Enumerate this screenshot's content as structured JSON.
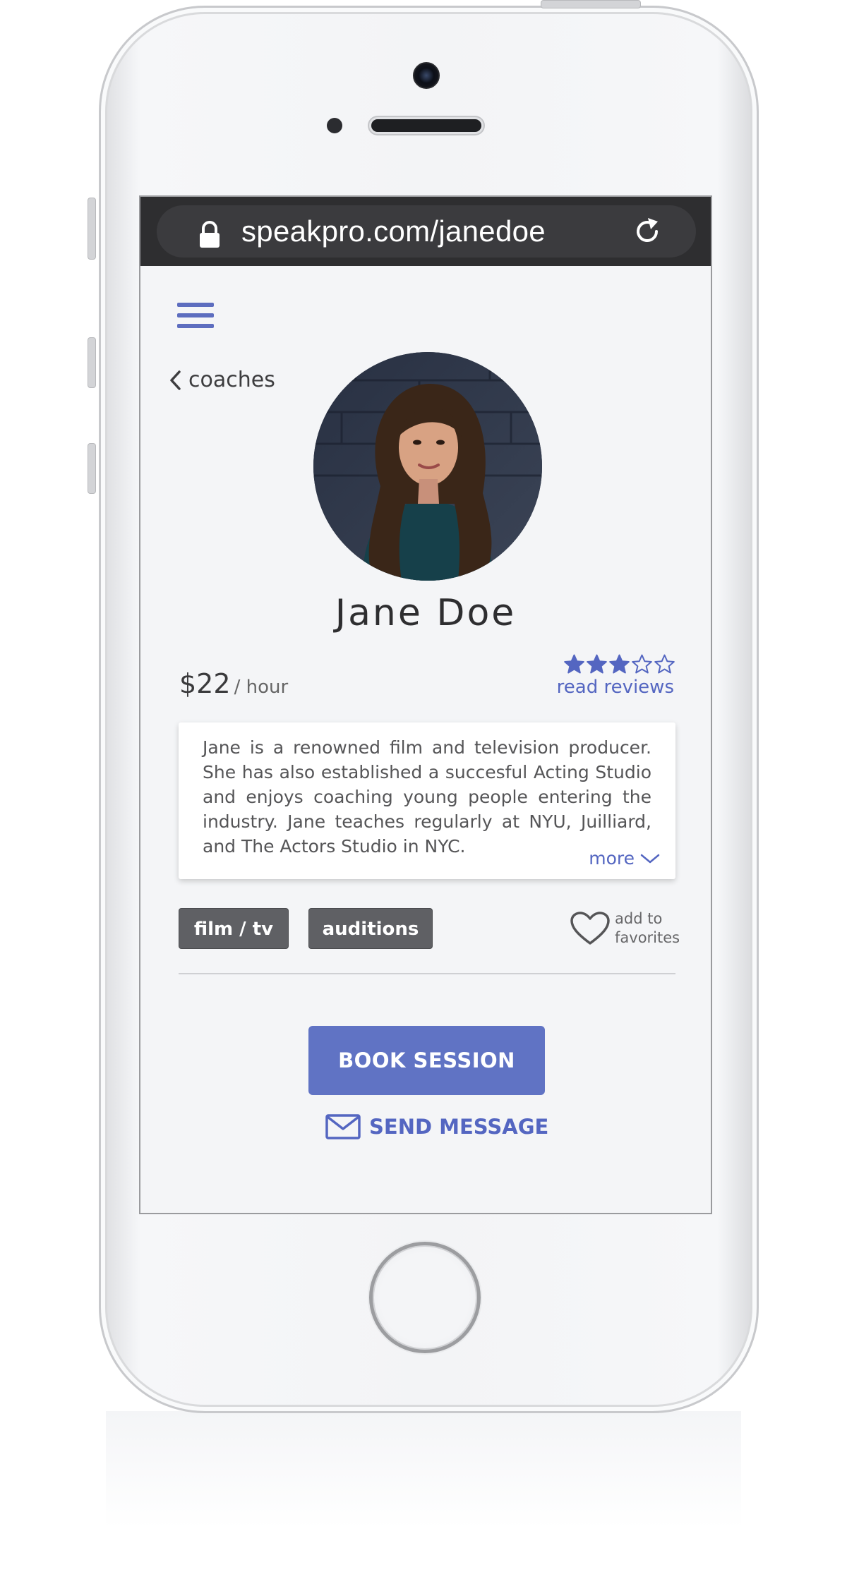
{
  "browser": {
    "url": "speakpro.com/janedoe",
    "lock_icon": "lock-icon",
    "reload_icon": "reload-icon"
  },
  "nav": {
    "menu_icon": "hamburger-menu-icon",
    "back_label": "coaches"
  },
  "profile": {
    "name": "Jane Doe",
    "price": "$22",
    "price_unit": "/ hour",
    "rating": 3,
    "rating_max": 5,
    "reviews_link": "read reviews",
    "bio": "Jane is a renowned film and television producer. She has also established a succesful Acting Studio and enjoys coaching young people entering the industry. Jane teaches regularly at NYU, Juilliard, and The Actors Studio in NYC.",
    "more_label": "more",
    "tags": [
      "film / tv",
      "auditions"
    ],
    "favorite_line1": "add to",
    "favorite_line2": "favorites"
  },
  "actions": {
    "book_label": "BOOK SESSION",
    "message_label": "SEND MESSAGE"
  },
  "colors": {
    "accent": "#6073c4",
    "link": "#5466c1",
    "tag_bg": "#5f6064",
    "url_bar": "#2e2e30"
  }
}
